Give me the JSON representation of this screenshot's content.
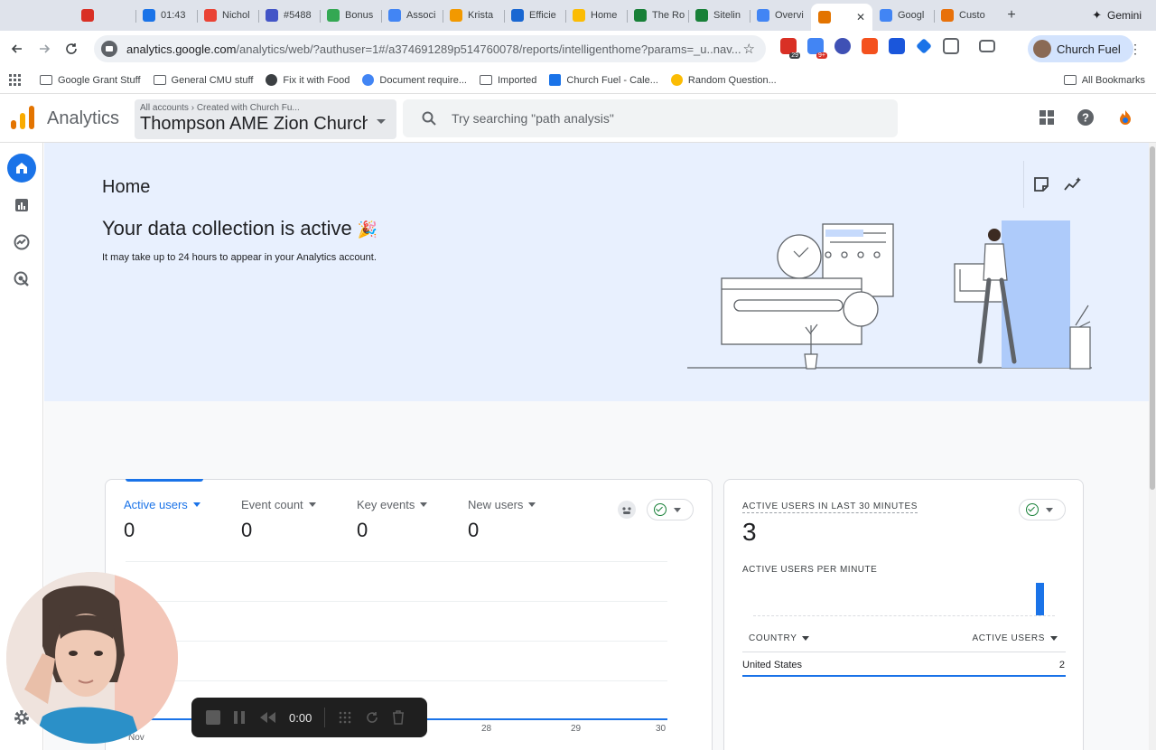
{
  "browser": {
    "tabs": [
      {
        "label": "",
        "favicon_color": "#d93025"
      },
      {
        "label": "01:43",
        "favicon_color": "#1a73e8"
      },
      {
        "label": "Nichol",
        "favicon_color": "#ea4335"
      },
      {
        "label": "#5488",
        "favicon_color": "#4355c7"
      },
      {
        "label": "Bonus",
        "favicon_color": "#34a853"
      },
      {
        "label": "Associ",
        "favicon_color": "#4285f4"
      },
      {
        "label": "Krista",
        "favicon_color": "#f29900"
      },
      {
        "label": "Efficie",
        "favicon_color": "#1967d2"
      },
      {
        "label": "Home",
        "favicon_color": "#fbbc04"
      },
      {
        "label": "The Ro",
        "favicon_color": "#188038"
      },
      {
        "label": "Sitelin",
        "favicon_color": "#188038"
      },
      {
        "label": "Overvi",
        "favicon_color": "#4285f4"
      },
      {
        "label": "",
        "favicon_color": "#e37400",
        "active": true
      },
      {
        "label": "Googl",
        "favicon_color": "#4285f4"
      },
      {
        "label": "Custo",
        "favicon_color": "#e8710a"
      }
    ],
    "gemini_label": "Gemini",
    "url_host": "analytics.google.com",
    "url_path": "/analytics/web/?authuser=1#/a374691289p514760078/reports/intelligenthome?params=_u..nav...",
    "profile_name": "Church Fuel",
    "ext_badges": [
      "29",
      "9+"
    ],
    "bookmarks": [
      {
        "label": "Google Grant Stuff",
        "icon": "folder-icon"
      },
      {
        "label": "General CMU stuff",
        "icon": "folder-icon"
      },
      {
        "label": "Fix it with Food",
        "icon": "globe-icon"
      },
      {
        "label": "Document require...",
        "icon": "google-icon"
      },
      {
        "label": "Imported",
        "icon": "folder-icon"
      },
      {
        "label": "Church Fuel - Cale...",
        "icon": "calendar-icon"
      },
      {
        "label": "Random Question...",
        "icon": "chat-icon"
      }
    ],
    "all_bookmarks": "All Bookmarks"
  },
  "ga": {
    "product": "Analytics",
    "crumb": "All accounts",
    "crumb_child": "Created with Church Fu...",
    "property": "Thompson AME Zion Church...",
    "search_placeholder": "Try searching \"path analysis\""
  },
  "home": {
    "title": "Home",
    "headline": "Your data collection is active",
    "headline_emoji": "🎉",
    "subtext": "It may take up to 24 hours to appear in your Analytics account."
  },
  "overview": {
    "metrics": [
      {
        "label": "Active users",
        "value": "0",
        "selected": true
      },
      {
        "label": "Event count",
        "value": "0"
      },
      {
        "label": "Key events",
        "value": "0"
      },
      {
        "label": "New users",
        "value": "0"
      }
    ],
    "x_ticks": [
      "Nov",
      "28",
      "29",
      "30"
    ]
  },
  "realtime": {
    "title": "ACTIVE USERS IN LAST 30 MINUTES",
    "value": "3",
    "per_minute_label": "ACTIVE USERS PER MINUTE",
    "col_country": "COUNTRY",
    "col_users": "ACTIVE USERS",
    "rows": [
      {
        "country": "United States",
        "users": "2"
      }
    ]
  },
  "recorder": {
    "time": "0:00"
  },
  "colors": {
    "accent": "#1a73e8",
    "success": "#188038",
    "hero_bg": "#e8f0fe"
  }
}
